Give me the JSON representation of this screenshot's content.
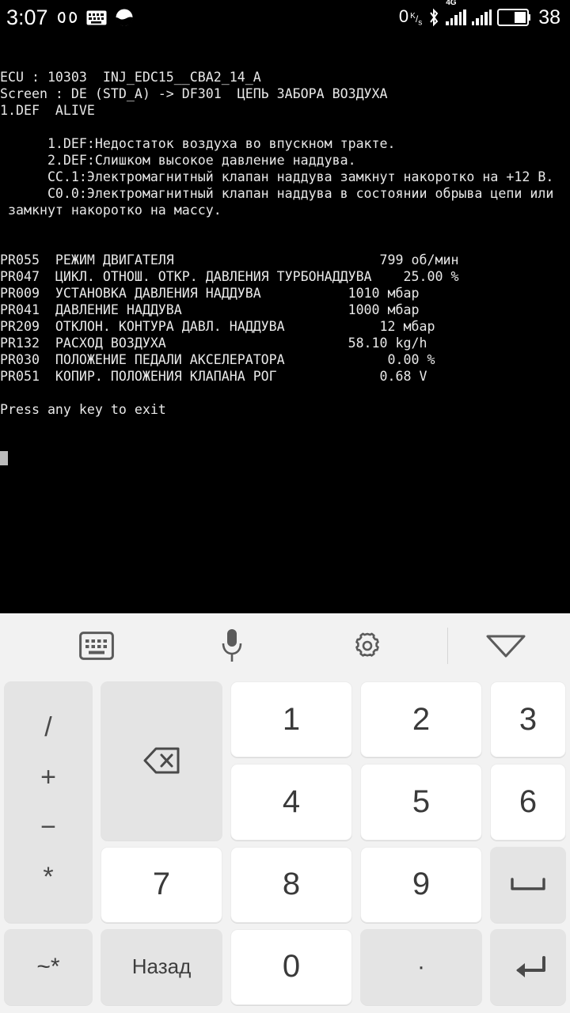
{
  "status_bar": {
    "clock": "3:07",
    "icons_left": [
      "infinity-icon",
      "keyboard-icon",
      "weather-icon"
    ],
    "net_speed_value": "0",
    "net_speed_unit_num": "K",
    "net_speed_unit_den": "s",
    "bluetooth": "bluetooth-icon",
    "network_type": "4G",
    "battery_percent": "38"
  },
  "terminal": {
    "lines": [
      "ECU : 10303  INJ_EDC15__CBA2_14_A",
      "Screen : DE (STD_A) -> DF301  ЦЕПЬ ЗАБОРА ВОЗДУХА",
      "1.DEF  ALIVE",
      "",
      "      1.DEF:Недостаток воздуха во впускном тракте.",
      "      2.DEF:Слишком высокое давление наддува.",
      "      CC.1:Электромагнитный клапан наддува замкнут накоротко на +12 В.",
      "      C0.0:Электромагнитный клапан наддува в состоянии обрыва цепи или",
      " замкнут накоротко на массу.",
      "",
      "",
      "PR055  РЕЖИМ ДВИГАТЕЛЯ                          799 об/мин",
      "PR047  ЦИКЛ. ОТНОШ. ОТКР. ДАВЛЕНИЯ ТУРБОНАДДУВА    25.00 %",
      "PR009  УСТАНОВКА ДАВЛЕНИЯ НАДДУВА           1010 мбар",
      "PR041  ДАВЛЕНИЕ НАДДУВА                     1000 мбар",
      "PR209  ОТКЛОН. КОНТУРА ДАВЛ. НАДДУВА            12 мбар",
      "PR132  РАСХОД ВОЗДУХА                       58.10 kg/h",
      "PR030  ПОЛОЖЕНИЕ ПЕДАЛИ АКСЕЛЕРАТОРА             0.00 %",
      "PR051  КОПИР. ПОЛОЖЕНИЯ КЛАПАНА РОГ             0.68 V",
      "",
      "Press any key to exit"
    ],
    "header": {
      "ecu_label": "ECU",
      "ecu_id": "10303",
      "ecu_name": "INJ_EDC15__CBA2_14_A",
      "screen_label": "Screen",
      "screen_value": "DE (STD_A) -> DF301",
      "screen_title": "ЦЕПЬ ЗАБОРА ВОЗДУХА",
      "fault_code": "1.DEF",
      "fault_state": "ALIVE"
    },
    "fault_descriptions": [
      {
        "code": "1.DEF",
        "text": "Недостаток воздуха во впускном тракте."
      },
      {
        "code": "2.DEF",
        "text": "Слишком высокое давление наддува."
      },
      {
        "code": "CC.1",
        "text": "Электромагнитный клапан наддува замкнут накоротко на +12 В."
      },
      {
        "code": "C0.0",
        "text": "Электромагнитный клапан наддува в состоянии обрыва цепи или замкнут накоротко на массу."
      }
    ],
    "parameters": [
      {
        "id": "PR055",
        "name": "РЕЖИМ ДВИГАТЕЛЯ",
        "value": "799",
        "unit": "об/мин"
      },
      {
        "id": "PR047",
        "name": "ЦИКЛ. ОТНОШ. ОТКР. ДАВЛЕНИЯ ТУРБОНАДДУВА",
        "value": "25.00",
        "unit": "%"
      },
      {
        "id": "PR009",
        "name": "УСТАНОВКА ДАВЛЕНИЯ НАДДУВА",
        "value": "1010",
        "unit": "мбар"
      },
      {
        "id": "PR041",
        "name": "ДАВЛЕНИЕ НАДДУВА",
        "value": "1000",
        "unit": "мбар"
      },
      {
        "id": "PR209",
        "name": "ОТКЛОН. КОНТУРА ДАВЛ. НАДДУВА",
        "value": "12",
        "unit": "мбар"
      },
      {
        "id": "PR132",
        "name": "РАСХОД ВОЗДУХА",
        "value": "58.10",
        "unit": "kg/h"
      },
      {
        "id": "PR030",
        "name": "ПОЛОЖЕНИЕ ПЕДАЛИ АКСЕЛЕРАТОРА",
        "value": "0.00",
        "unit": "%"
      },
      {
        "id": "PR051",
        "name": "КОПИР. ПОЛОЖЕНИЯ КЛАПАНА РОГ",
        "value": "0.68",
        "unit": "V"
      }
    ],
    "prompt": "Press any key to exit",
    "colors": {
      "bg": "#000000",
      "fg": "#e8e8e8",
      "cursor": "#bbbbbb"
    }
  },
  "keyboard": {
    "toolbar": [
      {
        "name": "keyboard-switch-icon",
        "label": "keyboard-icon"
      },
      {
        "name": "voice-input-icon",
        "label": "mic-icon"
      },
      {
        "name": "keyboard-settings-icon",
        "label": "gear-icon"
      },
      {
        "name": "hide-keyboard-icon",
        "label": "chevron-down-icon"
      }
    ],
    "ops_key": {
      "labels": [
        "/",
        "+",
        "−",
        "*"
      ]
    },
    "rows": [
      [
        "1",
        "2",
        "3"
      ],
      [
        "4",
        "5",
        "6"
      ],
      [
        "7",
        "8",
        "9"
      ]
    ],
    "backspace_label": "backspace-icon",
    "space_label": "space-icon",
    "enter_label": "enter-icon",
    "tilde_key": "~*",
    "back_key": "Назад",
    "zero_key": "0",
    "dot_key": "·",
    "colors": {
      "bg": "#f2f2f2",
      "num_key": "#ffffff",
      "func_key": "#e4e4e4",
      "text": "#3a3a3a"
    }
  }
}
